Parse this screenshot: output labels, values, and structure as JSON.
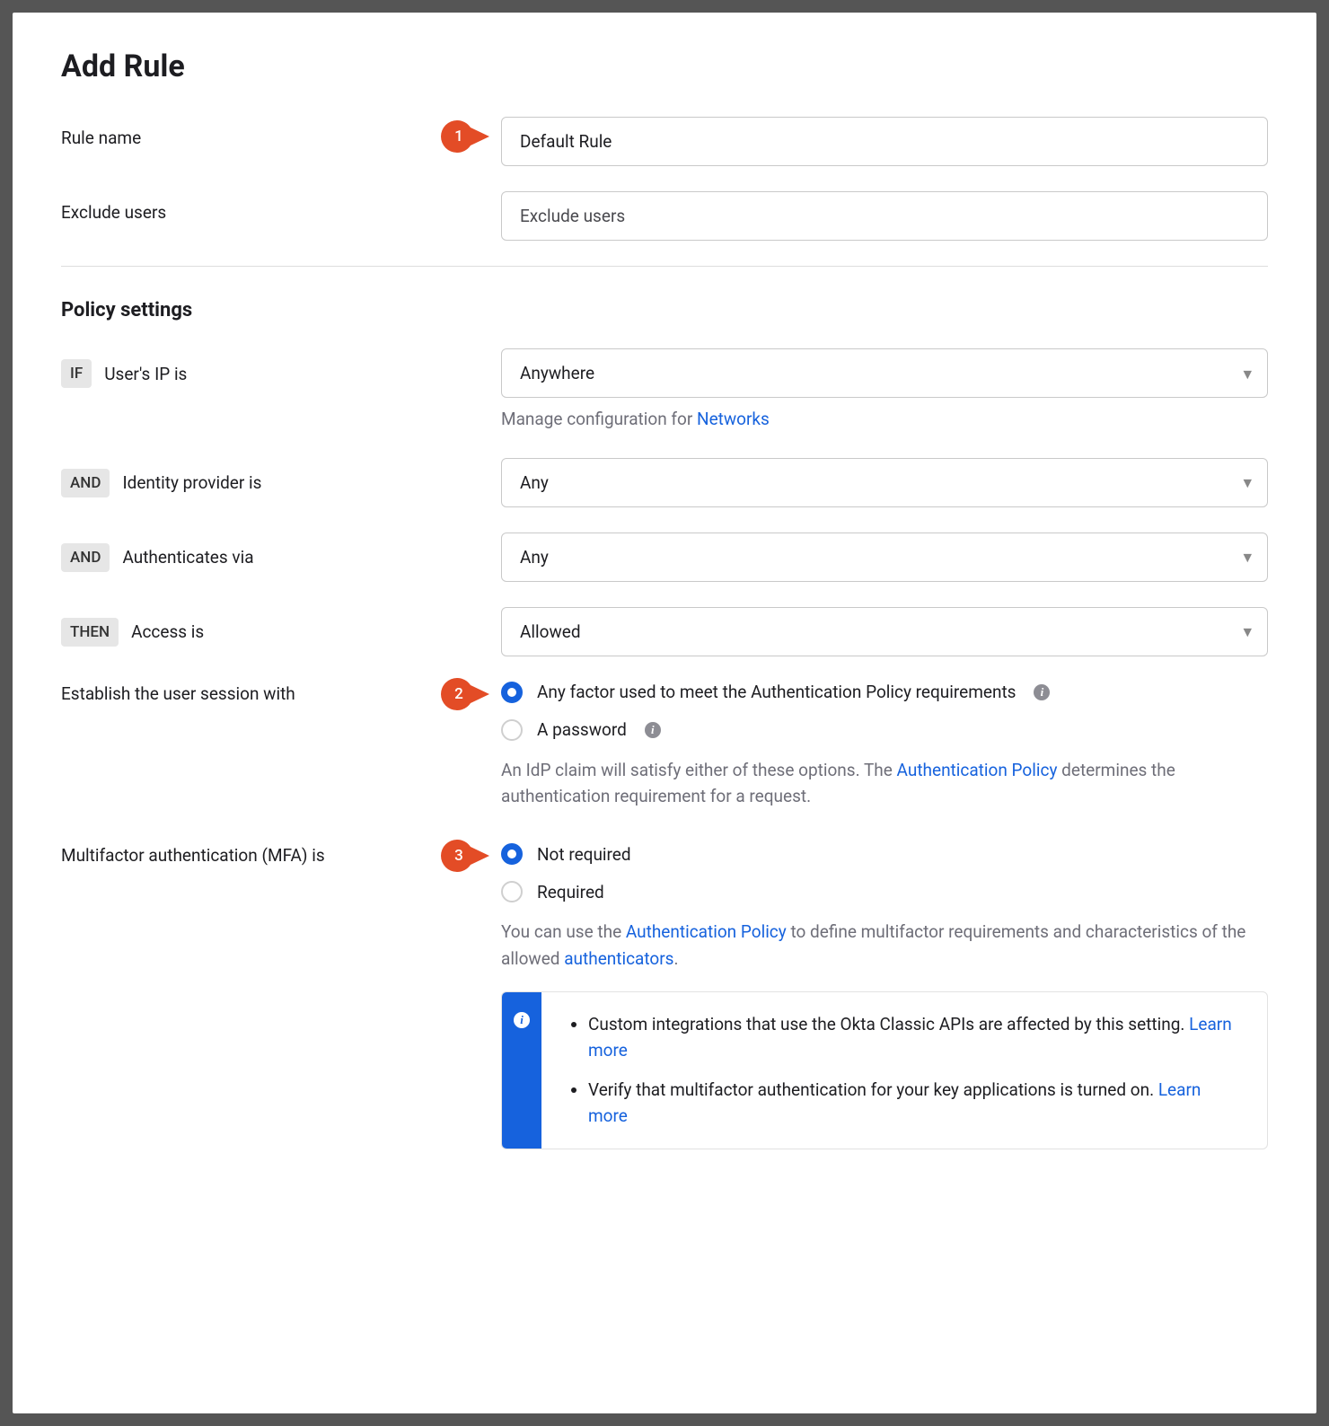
{
  "title": "Add Rule",
  "ruleName": {
    "label": "Rule name",
    "value": "Default Rule"
  },
  "excludeUsers": {
    "label": "Exclude users",
    "placeholder": "Exclude users"
  },
  "policySettings": {
    "heading": "Policy settings",
    "conditions": {
      "ifChip": "IF",
      "andChip": "AND",
      "thenChip": "THEN",
      "userIp": {
        "label": "User's IP is",
        "value": "Anywhere",
        "helper": "Manage configuration for ",
        "helperLink": "Networks"
      },
      "idp": {
        "label": "Identity provider is",
        "value": "Any"
      },
      "authVia": {
        "label": "Authenticates via",
        "value": "Any"
      },
      "access": {
        "label": "Access is",
        "value": "Allowed"
      }
    }
  },
  "sessionFactor": {
    "label": "Establish the user session with",
    "options": {
      "anyFactor": "Any factor used to meet the Authentication Policy requirements",
      "password": "A password"
    },
    "note1": "An IdP claim will satisfy either of these options. The ",
    "noteLink": "Authentication Policy",
    "note2": " determines the authentication requirement for a request."
  },
  "mfa": {
    "label": "Multifactor authentication (MFA) is",
    "options": {
      "notRequired": "Not required",
      "required": "Required"
    },
    "note1": "You can use the ",
    "noteLink1": "Authentication Policy",
    "note2": " to define multifactor requirements and characteristics of the allowed ",
    "noteLink2": "authenticators",
    "note3": ".",
    "notice": {
      "item1a": "Custom integrations that use the Okta Classic APIs are affected by this setting. ",
      "item1Link": "Learn more",
      "item2a": "Verify that multifactor authentication for your key applications is turned on. ",
      "item2Link": "Learn more"
    }
  },
  "markers": {
    "m1": "1",
    "m2": "2",
    "m3": "3"
  }
}
